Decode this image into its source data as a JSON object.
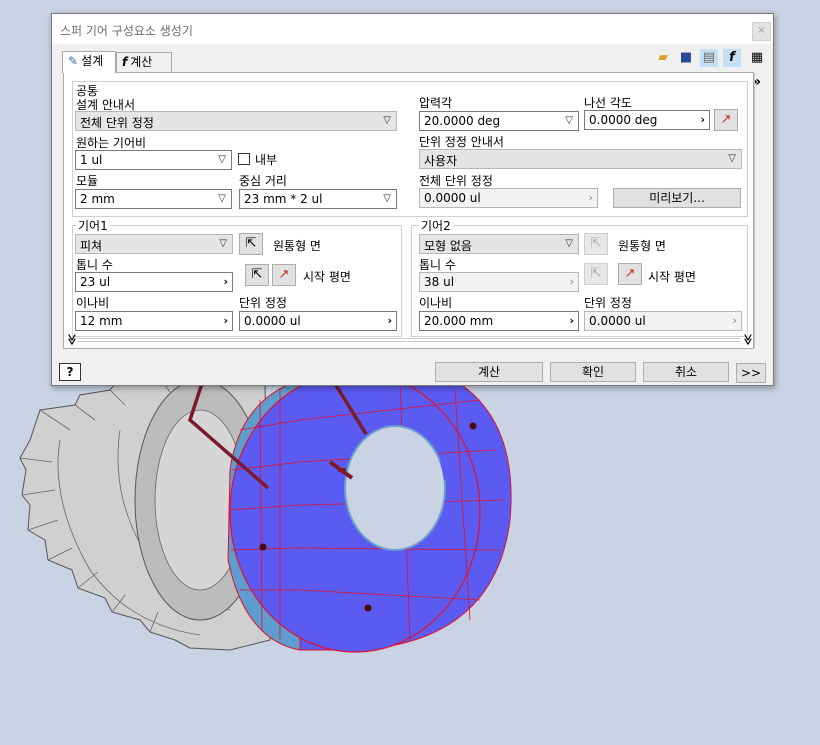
{
  "dialog": {
    "title": "스퍼 기어 구성요소 생성기",
    "close_glyph": "×",
    "tabs": [
      {
        "label": "설계",
        "icon": "pencil-gear-icon"
      },
      {
        "label": "계산",
        "icon": "fx-icon"
      }
    ],
    "toolbar_icons": [
      "open-folder-icon",
      "save-icon",
      "settings-icon",
      "fx-icon",
      "table-icon"
    ],
    "common": {
      "section": "공통",
      "design_guide_label": "설계 안내서",
      "design_guide_value": "전체 단위 정정",
      "pressure_angle_label": "압력각",
      "pressure_angle_value": "20.0000 deg",
      "helix_angle_label": "나선 각도",
      "helix_angle_value": "0.0000 deg",
      "ratio_label": "원하는 기어비",
      "ratio_value": "1 ul",
      "internal_label": "내부",
      "internal_checked": false,
      "unit_correction_guide_label": "단위 정정 안내서",
      "unit_correction_guide_value": "사용자",
      "module_label": "모듈",
      "module_value": "2 mm",
      "center_distance_label": "중심 거리",
      "center_distance_value": "23 mm * 2 ul",
      "total_unit_correction_label": "전체 단위 정정",
      "total_unit_correction_value": "0.0000 ul",
      "preview_button": "미리보기..."
    },
    "gear1": {
      "section": "기어1",
      "type_value": "피쳐",
      "cylindrical_face_label": "원통형 면",
      "teeth_label": "톱니 수",
      "teeth_value": "23 ul",
      "start_plane_label": "시작 평면",
      "face_width_label": "이나비",
      "face_width_value": "12 mm",
      "unit_correction_label": "단위 정정",
      "unit_correction_value": "0.0000 ul"
    },
    "gear2": {
      "section": "기어2",
      "type_value": "모형 없음",
      "cylindrical_face_label": "원통형 면",
      "teeth_label": "톱니 수",
      "teeth_value": "38 ul",
      "start_plane_label": "시작 평면",
      "face_width_label": "이나비",
      "face_width_value": "20.000 mm",
      "unit_correction_label": "단위 정정",
      "unit_correction_value": "0.0000 ul"
    },
    "footer": {
      "help_glyph": "?",
      "calculate": "계산",
      "ok": "확인",
      "cancel": "취소",
      "more": ">>"
    },
    "side_expand": "»",
    "collapse_glyph": "≫"
  },
  "colors": {
    "gear_blue": "#5b5bf2",
    "gear_light_blue": "#5f9cd0",
    "leader_line": "#7a1a2a",
    "edge_red": "#e0102a",
    "background": "#c9d3e4",
    "grey_gear": "#c8c8c8"
  }
}
